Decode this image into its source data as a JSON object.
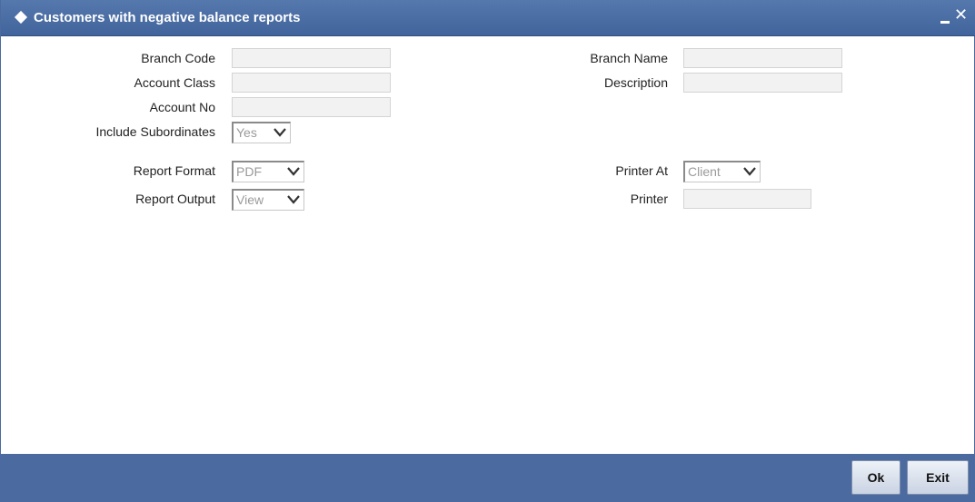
{
  "window": {
    "title": "Customers with negative balance reports",
    "title_bar_color": "#4a6aa0",
    "minimize_icon": "minimize-icon",
    "close_icon": "close-icon"
  },
  "form": {
    "branch_code": {
      "label": "Branch Code",
      "value": ""
    },
    "account_class": {
      "label": "Account Class",
      "value": ""
    },
    "account_no": {
      "label": "Account No",
      "value": ""
    },
    "include_subordinates": {
      "label": "Include Subordinates",
      "value": "Yes"
    },
    "branch_name": {
      "label": "Branch Name",
      "value": ""
    },
    "description": {
      "label": "Description",
      "value": ""
    },
    "report_format": {
      "label": "Report Format",
      "value": "PDF"
    },
    "report_output": {
      "label": "Report Output",
      "value": "View"
    },
    "printer_at": {
      "label": "Printer At",
      "value": "Client"
    },
    "printer": {
      "label": "Printer",
      "value": ""
    }
  },
  "footer": {
    "ok_label": "Ok",
    "exit_label": "Exit",
    "color": "#4a6aa0"
  }
}
